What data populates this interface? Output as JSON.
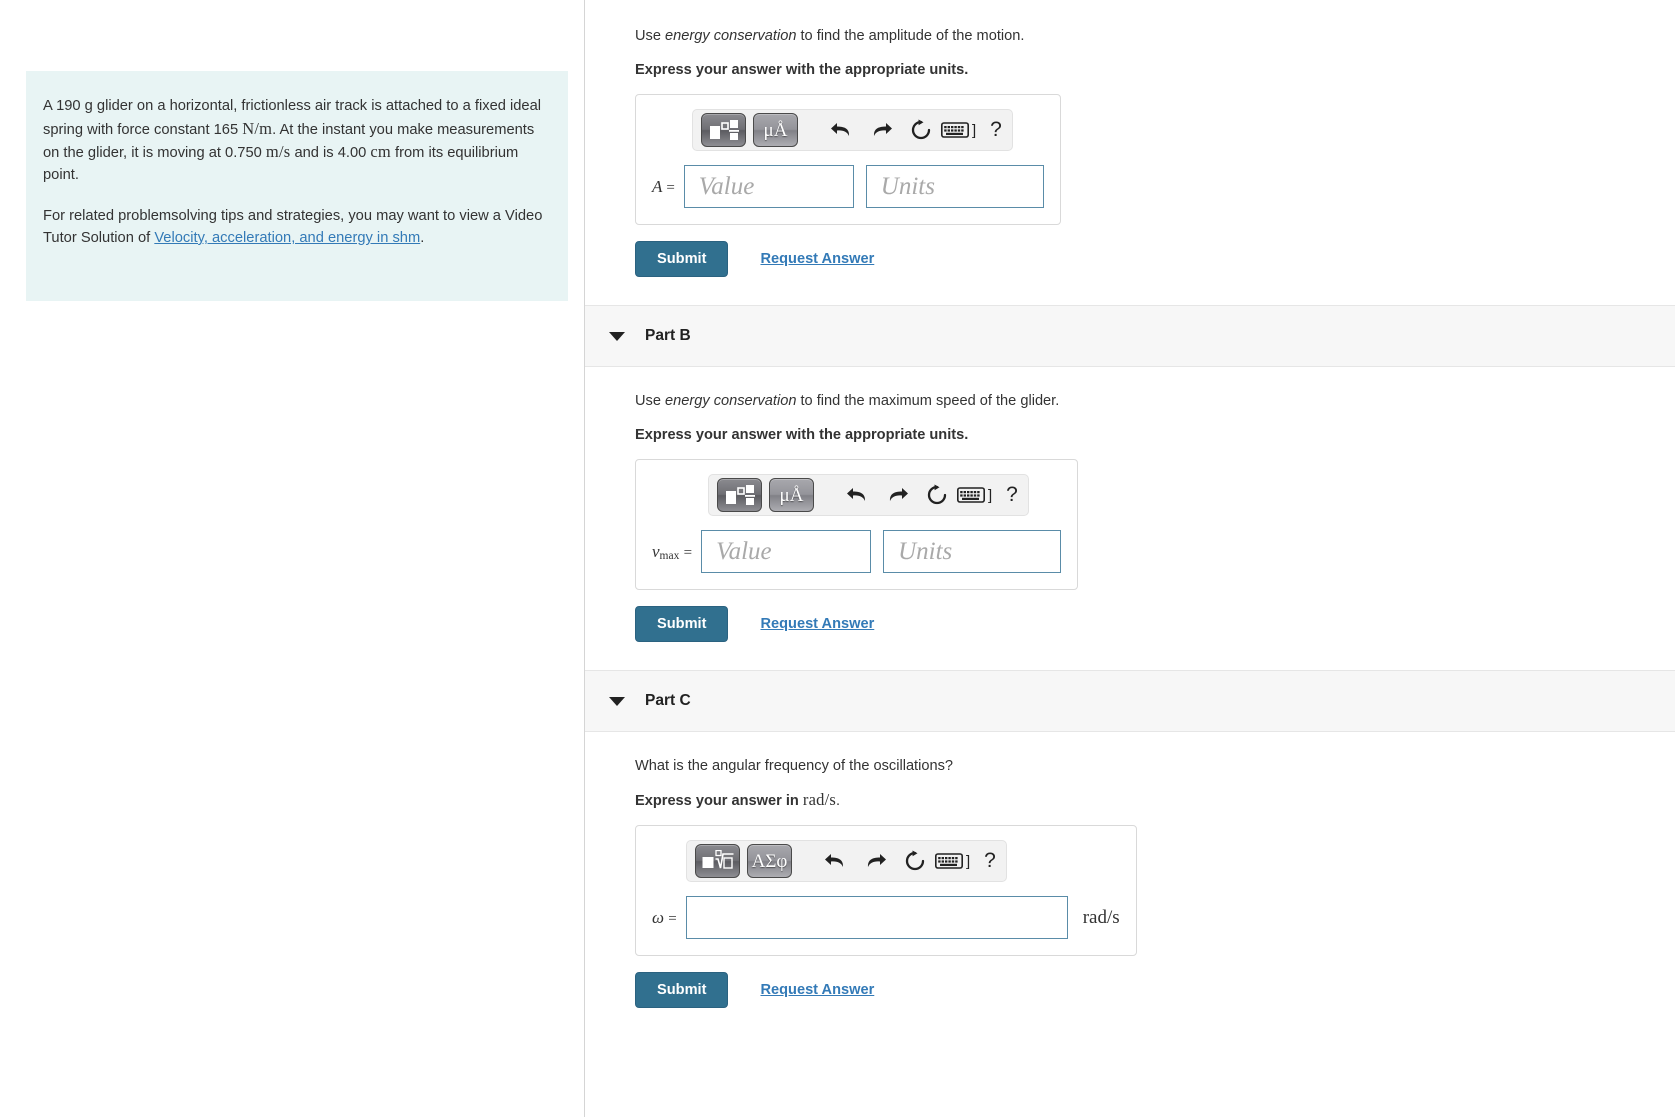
{
  "problem": {
    "paragraph1_part1": "A 190 g glider on a horizontal, frictionless air track is attached to a fixed ideal spring with force constant 165 ",
    "paragraph1_unit1": "N/m",
    "paragraph1_part2": ". At the instant you make measurements on the glider, it is moving at 0.750 ",
    "paragraph1_unit2": "m/s",
    "paragraph1_part3": " and is 4.00 ",
    "paragraph1_unit3": "cm",
    "paragraph1_part4": " from its equilibrium point.",
    "paragraph2_part1": "For related problemsolving tips and strategies, you may want to view a Video Tutor Solution of ",
    "paragraph2_link": "Velocity, acceleration, and energy in shm",
    "paragraph2_part2": "."
  },
  "toolbar": {
    "template_icon": "math-template-icon",
    "units_label": "μÅ",
    "greek_label": "ΑΣφ",
    "undo_icon": "undo-arrow-icon",
    "redo_icon": "redo-arrow-icon",
    "reset_icon": "reset-circle-icon",
    "keyboard_icon": "keyboard-icon",
    "keyboard_bracket": "]",
    "help_label": "?"
  },
  "parts": [
    {
      "id": "part-a",
      "header_visible": false,
      "title": "Part A",
      "prompt_pre": "Use ",
      "prompt_em": "energy conservation",
      "prompt_post": " to find the amplitude of the motion.",
      "instruction": "Express your answer with the appropriate units.",
      "instruction_unit": "",
      "variable": "A",
      "variable_sub": "",
      "equals": "=",
      "toolbar_type": "units",
      "field_type": "value-units",
      "value_placeholder": "Value",
      "units_placeholder": "Units",
      "input_value": "",
      "unit_suffix": "",
      "submit_label": "Submit",
      "request_label": "Request Answer"
    },
    {
      "id": "part-b",
      "header_visible": true,
      "title": "Part B",
      "prompt_pre": "Use ",
      "prompt_em": "energy conservation",
      "prompt_post": " to find the maximum speed of the glider.",
      "instruction": "Express your answer with the appropriate units.",
      "instruction_unit": "",
      "variable": "v",
      "variable_sub": "max",
      "equals": "=",
      "toolbar_type": "units",
      "field_type": "value-units",
      "value_placeholder": "Value",
      "units_placeholder": "Units",
      "input_value": "",
      "unit_suffix": "",
      "submit_label": "Submit",
      "request_label": "Request Answer"
    },
    {
      "id": "part-c",
      "header_visible": true,
      "title": "Part C",
      "prompt_pre": "",
      "prompt_em": "",
      "prompt_post": "What is the angular frequency of the oscillations?",
      "instruction": "Express your answer in ",
      "instruction_unit": "rad/s",
      "instruction_end": ".",
      "variable": "ω",
      "variable_sub": "",
      "equals": "=",
      "toolbar_type": "greek",
      "field_type": "single",
      "value_placeholder": "",
      "units_placeholder": "",
      "input_value": "",
      "unit_suffix": "rad/s",
      "submit_label": "Submit",
      "request_label": "Request Answer"
    }
  ],
  "colors": {
    "problem_bg": "#e8f4f4",
    "link": "#337ab7",
    "submit_bg": "#31708f",
    "part_header_bg": "#f7f7f7",
    "field_border": "#5a8ca8"
  }
}
